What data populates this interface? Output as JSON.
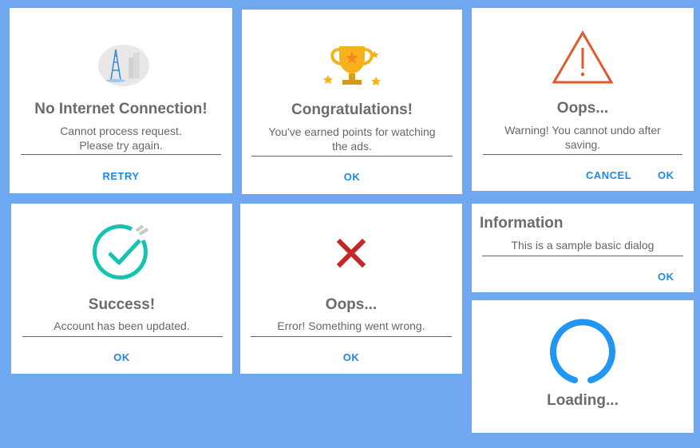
{
  "colors": {
    "background": "#6fa8f0",
    "accent": "#1e88e5",
    "success": "#14c3b1",
    "error": "#c62828",
    "warning": "#e25a2b",
    "loading": "#2196f3"
  },
  "dialogs": {
    "no_internet": {
      "icon": "cell-tower-icon",
      "title": "No Internet Connection!",
      "message": "Cannot process request.\nPlease try again.",
      "button": "RETRY"
    },
    "congrats": {
      "icon": "trophy-icon",
      "title": "Congratulations!",
      "message": "You've earned points for watching the ads.",
      "button": "OK"
    },
    "warning": {
      "icon": "warning-triangle-icon",
      "title": "Oops...",
      "message": "Warning! You cannot undo after saving.",
      "cancel": "CANCEL",
      "ok": "OK"
    },
    "success": {
      "icon": "check-circle-icon",
      "title": "Success!",
      "message": "Account has been updated.",
      "button": "OK"
    },
    "error": {
      "icon": "cross-icon",
      "title": "Oops...",
      "message": "Error! Something went wrong.",
      "button": "OK"
    },
    "info": {
      "title": "Information",
      "message": "This is a sample basic dialog",
      "button": "OK"
    },
    "loading": {
      "icon": "spinner-icon",
      "title": "Loading..."
    }
  }
}
